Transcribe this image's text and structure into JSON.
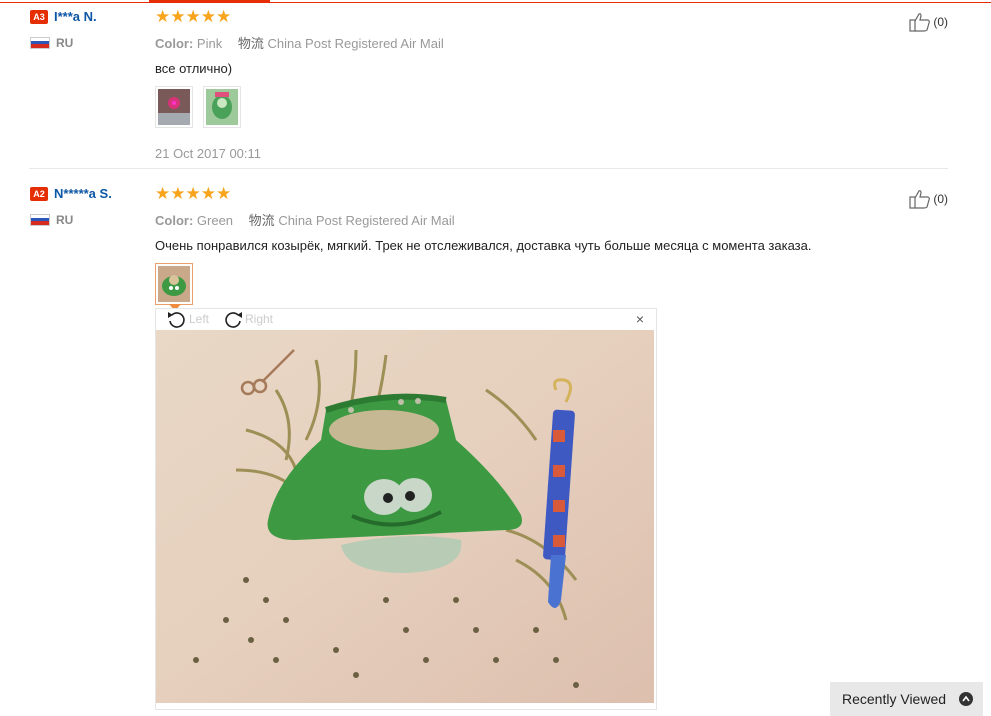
{
  "colors": {
    "accent": "#e62e04",
    "link": "#0b56a5",
    "star": "#f8a41c"
  },
  "reviews": [
    {
      "level": "A3",
      "name": "I***a N.",
      "country": "RU",
      "rating": 5,
      "stars": "★★★★★",
      "color_label": "Color:",
      "color_value": "Pink",
      "shipping_label": "物流",
      "shipping_value": "China Post Registered Air Mail",
      "text": "все отлично)",
      "thumbnails": 2,
      "date": "21 Oct 2017 00:11",
      "helpful": "(0)"
    },
    {
      "level": "A2",
      "name": "N*****a S.",
      "country": "RU",
      "rating": 5,
      "stars": "★★★★★",
      "color_label": "Color:",
      "color_value": "Green",
      "shipping_label": "物流",
      "shipping_value": "China Post Registered Air Mail",
      "text": "Очень понравился козырёк, мягкий. Трек не отслеживался, доставка чуть больше месяца с момента заказа.",
      "thumbnails": 1,
      "helpful": "(0)"
    }
  ],
  "viewer": {
    "rotate_left": "Left",
    "rotate_right": "Right",
    "close": "×"
  },
  "recently_viewed": "Recently Viewed",
  "icons": [
    "thumbs-up-icon",
    "rotate-left-icon",
    "rotate-right-icon",
    "close-icon",
    "chevron-up-icon"
  ]
}
